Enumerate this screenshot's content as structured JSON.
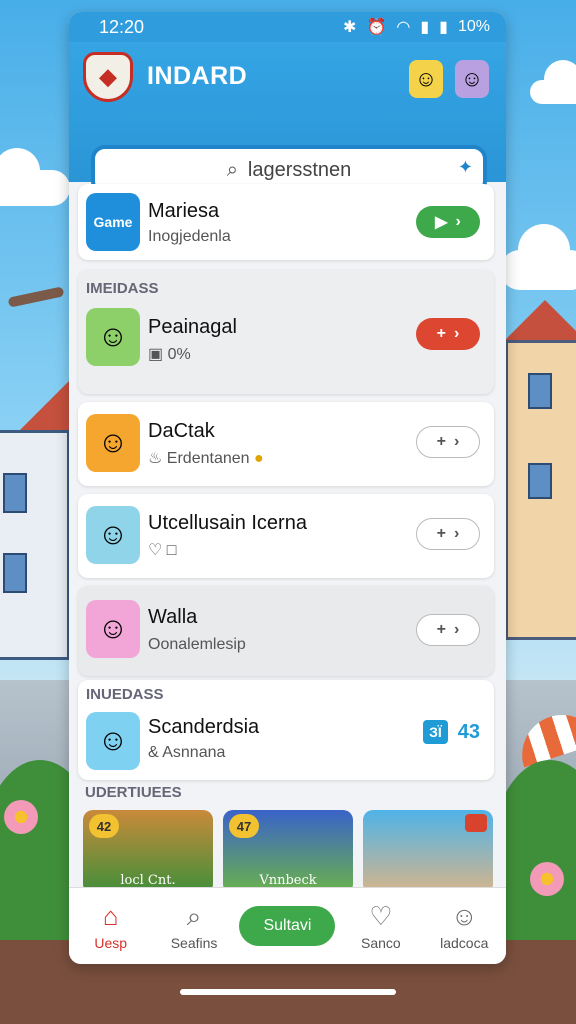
{
  "statusbar": {
    "time": "12:20",
    "battery": "10%",
    "icons": [
      "bluetooth-icon",
      "alarm-icon",
      "wifi-icon",
      "signal-icon",
      "battery-icon"
    ]
  },
  "header": {
    "app_title": "INDARD",
    "search_text": "lagersstnen"
  },
  "colors": {
    "header_blue": "#2f9ddd",
    "accent_green": "#3ea94a",
    "accent_red": "#dd4630",
    "active_nav": "#d8312a"
  },
  "featured": {
    "thumb_label": "Game",
    "name": "Mariesa",
    "subtitle": "Inogjedenla"
  },
  "section1": {
    "label": "IMEIDASS",
    "items": [
      {
        "name": "Peainagal",
        "subtitle": "0%"
      },
      {
        "name": "DaCtak",
        "subtitle": "Erdentanen"
      },
      {
        "name": "Utcellusain Icerna",
        "subtitle": ""
      },
      {
        "name": "Walla",
        "subtitle": "Oonalemlesip"
      }
    ]
  },
  "section2": {
    "label": "INUEDASS",
    "item": {
      "name": "Scanderdsia",
      "subtitle": "Asnnana",
      "badge": "ЗЇ",
      "count": "43"
    }
  },
  "section3": {
    "label": "UDERTIUEES",
    "tiles": [
      {
        "badge": "42",
        "text": "locl Cnt."
      },
      {
        "badge": "47",
        "text": "Vnnbeck"
      },
      {
        "badge": "",
        "text": ""
      }
    ]
  },
  "nav": {
    "items": [
      {
        "label": "Uesp"
      },
      {
        "label": "Seafins"
      },
      {
        "label": "Sanco"
      },
      {
        "label": "ladcoca"
      }
    ],
    "center_label": "Sultavi"
  }
}
